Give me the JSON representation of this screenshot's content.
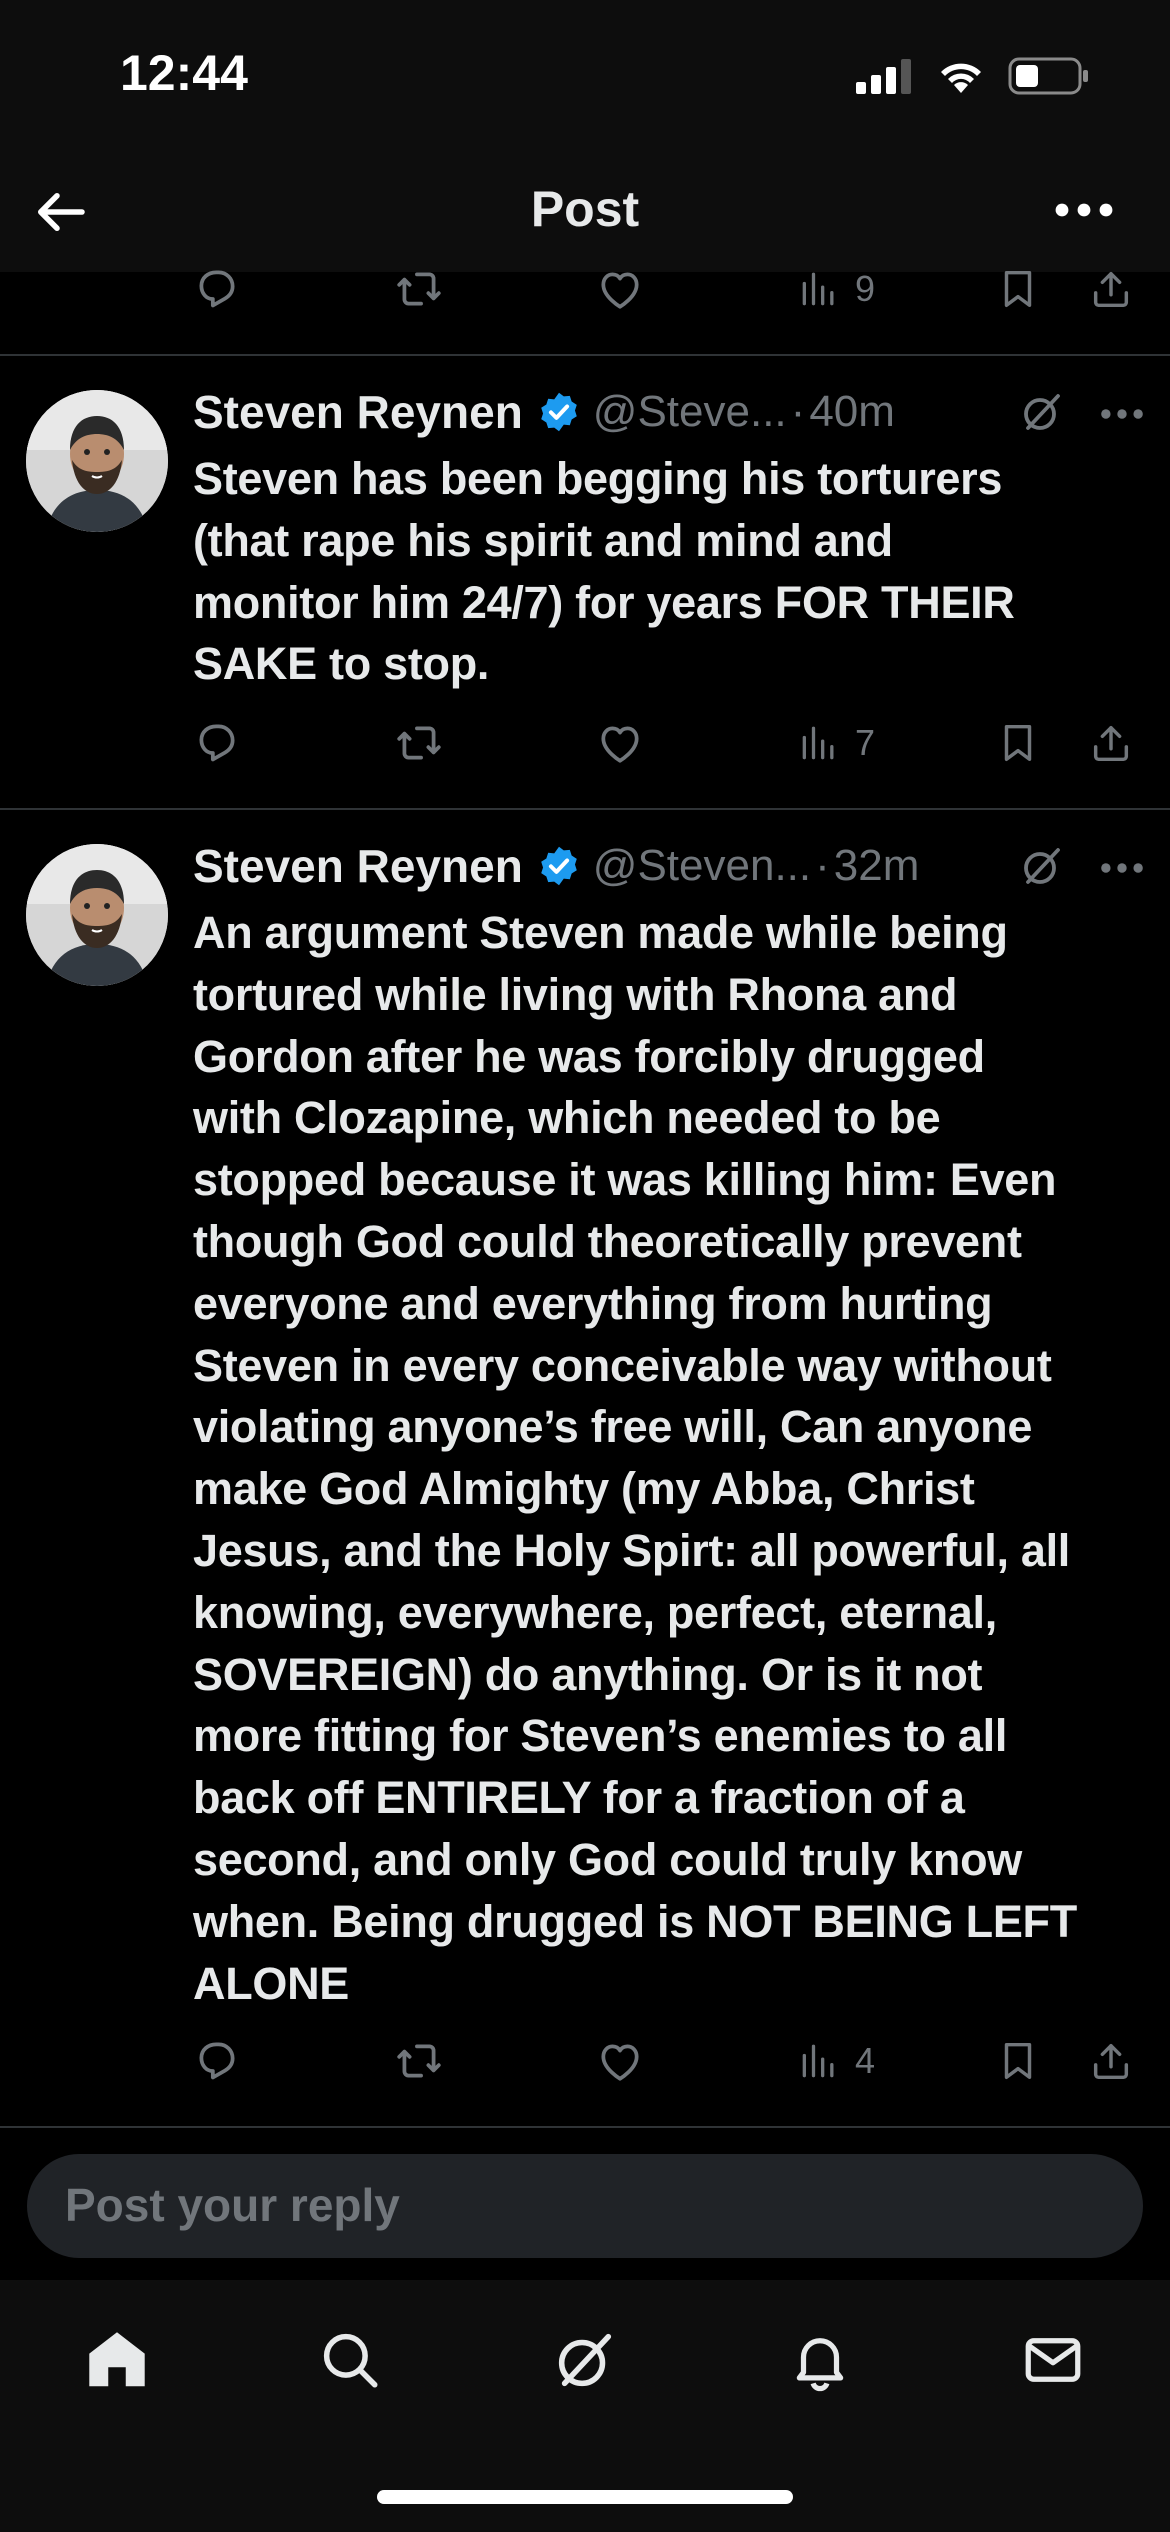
{
  "status_bar": {
    "time": "12:44"
  },
  "nav": {
    "title": "Post"
  },
  "top_partial_actions": {
    "views": "9"
  },
  "tweets": [
    {
      "name": "Steven Reynen",
      "handle": "@Steve...",
      "separator": "·",
      "time": "40m",
      "lines": [
        "Steven has been begging his torturers",
        "(that rape his spirit and mind and",
        "monitor him 24/7) for years FOR THEIR",
        "SAKE to stop."
      ],
      "views": "7"
    },
    {
      "name": "Steven Reynen",
      "handle": "@Steven...",
      "separator": "·",
      "time": "32m",
      "lines": [
        "An argument Steven made while being",
        "tortured while living with Rhona and",
        "Gordon after he was forcibly drugged",
        "with Clozapine, which needed to be",
        "stopped because it was killing him: Even",
        "though God could theoretically prevent",
        "everyone and everything from hurting",
        "Steven in every conceivable way without",
        "violating anyone’s free will, Can anyone",
        "make God Almighty (my Abba, Christ",
        "Jesus, and the Holy Spirt: all powerful, all",
        "knowing, everywhere, perfect, eternal,",
        "SOVEREIGN) do anything. Or is it not",
        "more fitting for Steven’s enemies to all",
        "back off ENTIRELY for a fraction of a",
        "second, and only God could truly know",
        "when. Being drugged is NOT BEING LEFT",
        "ALONE"
      ],
      "views": "4"
    }
  ],
  "reply": {
    "placeholder": "Post your reply"
  },
  "colors": {
    "background": "#000000",
    "text": "#e7e9ea",
    "muted": "#71767b",
    "verified": "#1d9bf0",
    "divider": "#2f3336"
  },
  "tab_bar": {
    "items": [
      {
        "icon": "home-icon",
        "active": true
      },
      {
        "icon": "search-icon"
      },
      {
        "icon": "grok-icon"
      },
      {
        "icon": "bell-icon"
      },
      {
        "icon": "mail-icon"
      }
    ]
  }
}
